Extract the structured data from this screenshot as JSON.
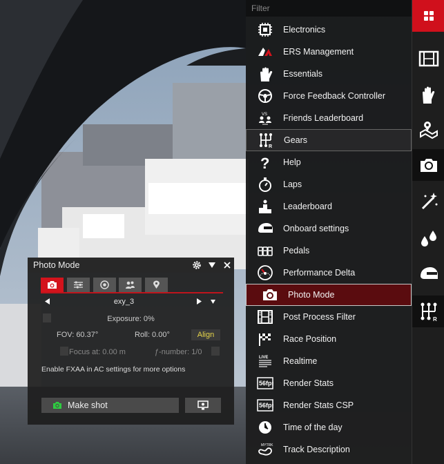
{
  "filter_label": "Filter",
  "apps": [
    {
      "label": "Electronics",
      "icon": "chip-icon",
      "state": ""
    },
    {
      "label": "ERS Management",
      "icon": "ers-icon",
      "state": ""
    },
    {
      "label": "Essentials",
      "icon": "glove-icon",
      "state": ""
    },
    {
      "label": "Force Feedback Controller",
      "icon": "steering-wheel-icon",
      "state": ""
    },
    {
      "label": "Friends Leaderboard",
      "icon": "friends-icon",
      "state": ""
    },
    {
      "label": "Gears",
      "icon": "gearshift-icon",
      "state": "hover"
    },
    {
      "label": "Help",
      "icon": "question-icon",
      "state": ""
    },
    {
      "label": "Laps",
      "icon": "stopwatch-icon",
      "state": ""
    },
    {
      "label": "Leaderboard",
      "icon": "podium-icon",
      "state": ""
    },
    {
      "label": "Onboard settings",
      "icon": "helmet-icon",
      "state": ""
    },
    {
      "label": "Pedals",
      "icon": "pedals-icon",
      "state": ""
    },
    {
      "label": "Performance Delta",
      "icon": "gauge-icon",
      "state": ""
    },
    {
      "label": "Photo Mode",
      "icon": "camera-icon",
      "state": "selected"
    },
    {
      "label": "Post Process Filter",
      "icon": "film-icon",
      "state": ""
    },
    {
      "label": "Race Position",
      "icon": "flag-icon",
      "state": ""
    },
    {
      "label": "Realtime",
      "icon": "live-icon",
      "state": ""
    },
    {
      "label": "Render Stats",
      "icon": "fps-icon",
      "state": ""
    },
    {
      "label": "Render Stats CSP",
      "icon": "fps-csp-icon",
      "state": ""
    },
    {
      "label": "Time of the day",
      "icon": "clock-icon",
      "state": ""
    },
    {
      "label": "Track Description",
      "icon": "track-icon",
      "state": ""
    }
  ],
  "photo_mode": {
    "title": "Photo Mode",
    "preset": "exy_3",
    "exposure": "Exposure: 0%",
    "fov": "FOV: 60.37°",
    "roll": "Roll: 0.00°",
    "align": "Align",
    "focus": "Focus at: 0.00 m",
    "fnumber": "ƒ-number: 1/0",
    "hint": "Enable FXAA in AC settings for more options",
    "make_shot": "Make shot"
  },
  "colors": {
    "accent": "#d3131c",
    "selected_bg": "#5a0c0f",
    "align_text": "#e7d64a",
    "shot_icon": "#2ecc40"
  }
}
